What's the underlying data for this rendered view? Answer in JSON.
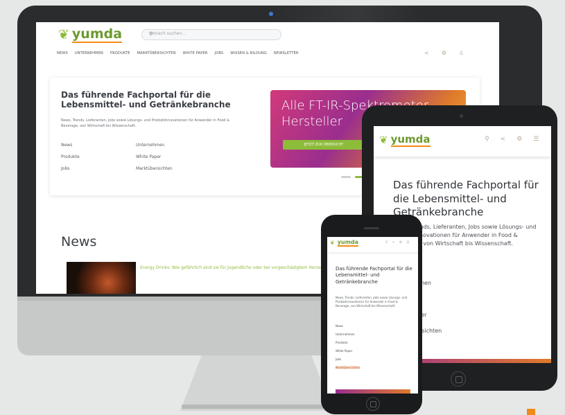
{
  "desktop": {
    "brand": "yumda",
    "search_placeholder": "Wonach suchen...",
    "nav": [
      "NEWS",
      "UNTERNEHMEN",
      "PRODUKTE",
      "MARKTÜBERSICHTEN",
      "WHITE PAPER",
      "JOBS",
      "WISSEN & BILDUNG",
      "NEWSLETTER"
    ],
    "hero": {
      "title": "Das führende Fachportal für die Lebensmittel- und Getränkebranche",
      "description": "News, Trends, Lieferanten, Jobs sowie Lösungs- und Produktinnovationen für Anwender in Food & Beverage, von Wirtschaft bis Wissenschaft.",
      "links": [
        "News",
        "Unternehmen",
        "Produkte",
        "White Paper",
        "Jobs",
        "Marktübersichten"
      ]
    },
    "banner": {
      "title": "Alle FT-IR-Spektrometer Hersteller",
      "button": "JETZT ZUR ÜBERSICHT"
    },
    "news": {
      "heading": "News",
      "teaser": "Energy Drinks: Wie gefährlich sind sie für Jugendliche oder bei vorgeschädigtem Herzen?"
    }
  },
  "tablet": {
    "brand": "yumda",
    "title": "Das führende Fachportal für die Lebensmittel- und Getränkebranche",
    "description": "News, Trends, Lieferanten, Jobs sowie Lösungs- und Produktinnovationen für Anwender in Food & Beverage, von Wirtschaft bis Wissenschaft.",
    "links": [
      "Unternehmen",
      "Produkte",
      "White Paper",
      "Marktübersichten"
    ]
  },
  "phone": {
    "brand": "yumda",
    "title": "Das führende Fachportal für die Lebensmittel- und Getränkebranche",
    "description": "News, Trends, Lieferanten, Jobs sowie Lösungs- und Produktinnovationen für Anwender in Food & Beverage, von Wirtschaft bis Wissenschaft.",
    "links": [
      "News",
      "Unternehmen",
      "Produkte",
      "White Paper",
      "Jobs",
      "Marktübersichten"
    ]
  },
  "icons": {
    "search": "search-icon",
    "share": "share-icon",
    "settings": "settings-icon",
    "user": "user-icon",
    "menu": "hamburger-menu-icon"
  },
  "colors": {
    "brand_green": "#8dbb3a",
    "accent_orange": "#f28c0f",
    "banner_gradient_start": "#d23a7a",
    "banner_gradient_end": "#f0b548"
  }
}
